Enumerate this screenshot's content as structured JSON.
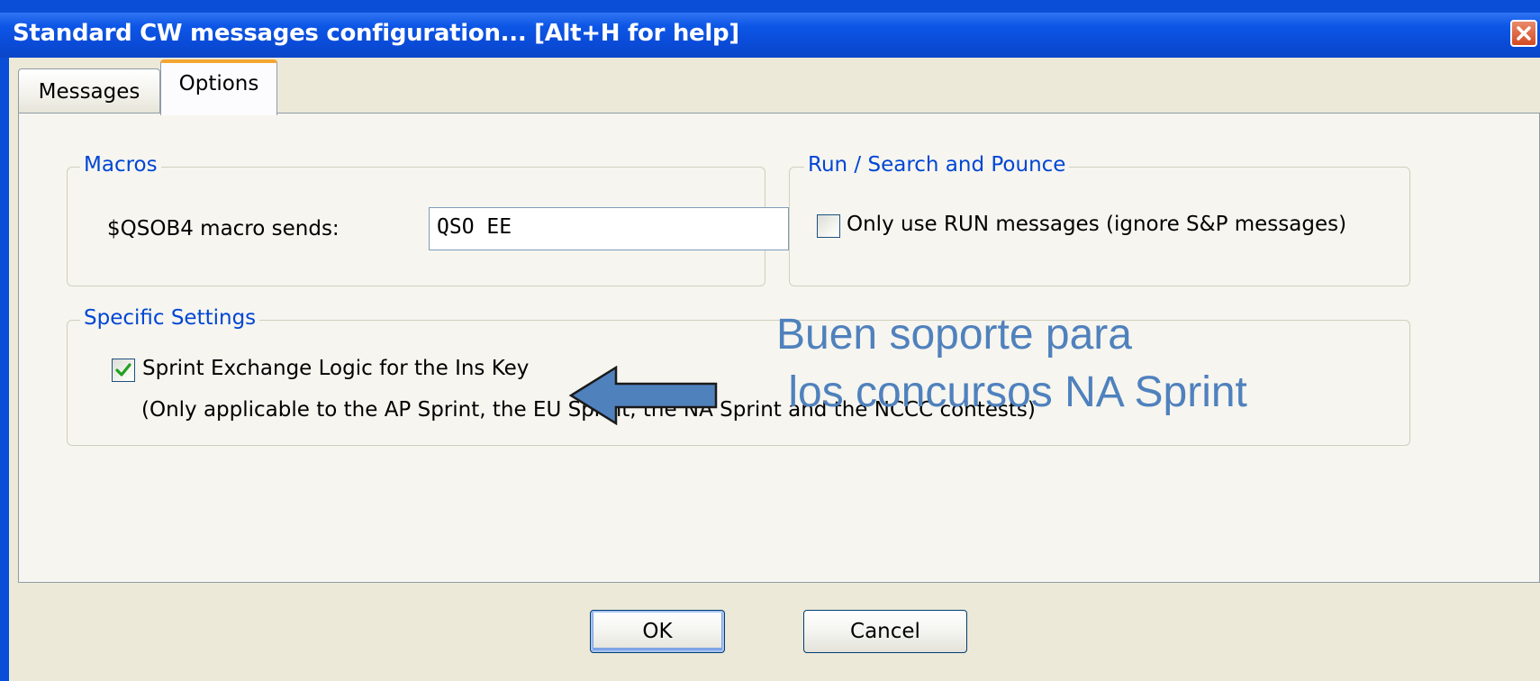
{
  "window": {
    "title": "Standard CW messages configuration... [Alt+H for help]"
  },
  "tabs": [
    {
      "label": "Messages",
      "selected": false
    },
    {
      "label": "Options",
      "selected": true
    }
  ],
  "macros": {
    "group_label": "Macros",
    "qsob4_label": "$QSOB4 macro sends:",
    "qsob4_value": "QSO EE"
  },
  "run_sp": {
    "group_label": "Run / Search and Pounce",
    "only_run_label": "Only use RUN messages (ignore S&P messages)",
    "only_run_checked": false
  },
  "specific": {
    "group_label": "Specific Settings",
    "sprint_label": "Sprint Exchange Logic for the Ins Key",
    "sprint_checked": true,
    "note": "(Only applicable to the AP Sprint, the EU Sprint, the NA Sprint and the NCCC contests)"
  },
  "annotation": {
    "line1": "Buen soporte para",
    "line2": " los concursos NA Sprint",
    "color": "#4f81bd"
  },
  "buttons": {
    "ok": "OK",
    "cancel": "Cancel"
  },
  "icons": {
    "close": "close-icon",
    "check": "check-icon",
    "arrow": "left-arrow-icon"
  }
}
